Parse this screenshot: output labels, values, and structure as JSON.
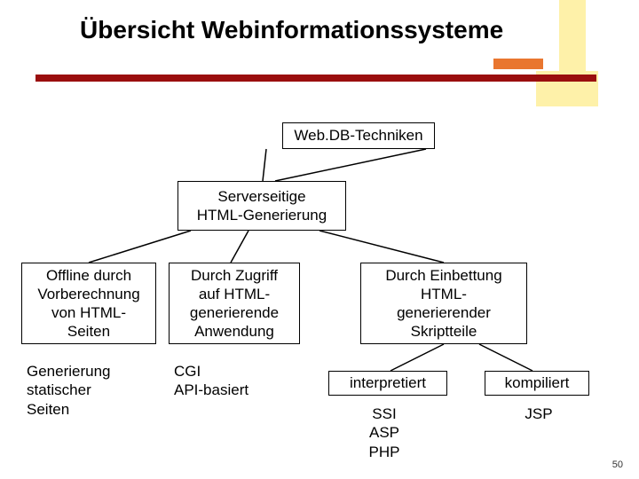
{
  "slide": {
    "title": "Übersicht Webinformationssysteme",
    "page_number": "50"
  },
  "nodes": {
    "root": "Web.DB-Techniken",
    "server_side": "Serverseitige\nHTML-Generierung",
    "offline": "Offline durch\nVorberechnung\nvon HTML-\nSeiten",
    "access": "Durch Zugriff\nauf HTML-\ngenerierende\nAnwendung",
    "embed": "Durch Einbettung\nHTML-\ngenerierender\nSkriptteile",
    "static_gen": "Generierung\nstatischer\nSeiten",
    "cgi_api": "CGI\nAPI-basiert",
    "interpreted": "interpretiert",
    "compiled": "kompiliert",
    "interp_examples": "SSI\nASP\nPHP",
    "compiled_examples": "JSP"
  }
}
